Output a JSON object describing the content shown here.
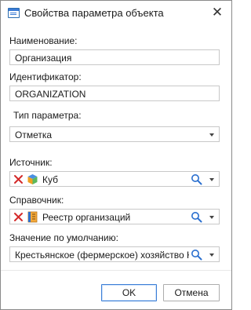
{
  "dialog": {
    "title": "Свойства параметра объекта",
    "close_glyph": "✕"
  },
  "fields": {
    "name": {
      "label": "Наименование:",
      "value": "Организация"
    },
    "identifier": {
      "label": "Идентификатор:",
      "value": "ORGANIZATION"
    },
    "param_type": {
      "label": "Тип параметра:",
      "value": "Отметка"
    },
    "source": {
      "label": "Источник:",
      "value": "Куб",
      "icon": "cube-icon"
    },
    "dictionary": {
      "label": "Справочник:",
      "value": "Реестр организаций",
      "icon": "dictionary-icon"
    },
    "default_value": {
      "label": "Значение по умолчанию:",
      "value": "Крестьянское (фермерское) хозяйство Кузь"
    }
  },
  "buttons": {
    "ok": "OK",
    "cancel": "Отмена"
  },
  "colors": {
    "accent": "#3c7fd6",
    "clear_red": "#d42a2a",
    "search_blue": "#2a6fcf"
  }
}
